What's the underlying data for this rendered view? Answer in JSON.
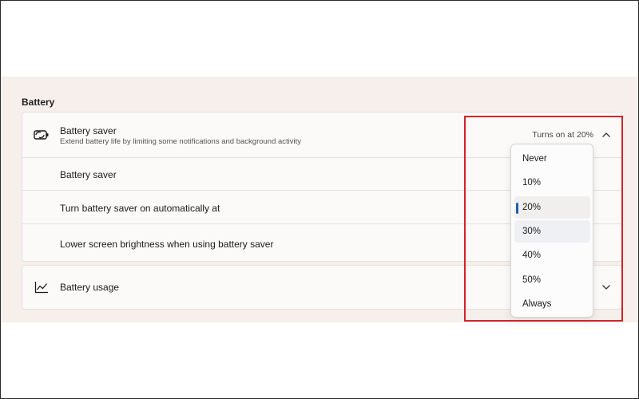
{
  "section": {
    "title": "Battery"
  },
  "battery_saver_card": {
    "title": "Battery saver",
    "subtitle": "Extend battery life by limiting some notifications and background activity",
    "status": "Turns on at 20%",
    "icon": "battery-saver-icon",
    "expanded": true,
    "rows": [
      {
        "label": "Battery saver"
      },
      {
        "label": "Turn battery saver on automatically at"
      },
      {
        "label": "Lower screen brightness when using battery saver"
      }
    ]
  },
  "battery_usage_card": {
    "title": "Battery usage",
    "icon": "line-chart-icon"
  },
  "dropdown": {
    "options": [
      "Never",
      "10%",
      "20%",
      "30%",
      "40%",
      "50%",
      "Always"
    ],
    "selected": "20%",
    "hovered": "30%"
  },
  "colors": {
    "accent": "#1f5fae",
    "highlight_border": "#d0252b",
    "panel_background": "#f7efec"
  }
}
